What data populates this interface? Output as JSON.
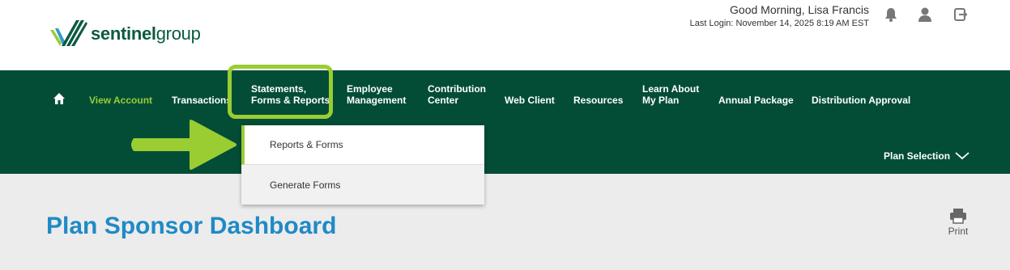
{
  "header": {
    "logo": {
      "bold": "sentinel",
      "light": "group"
    },
    "greeting": "Good Morning,  Lisa Francis",
    "last_login": "Last Login: November 14, 2025 8:19 AM EST",
    "icons": [
      "bell-icon",
      "user-icon",
      "logout-icon"
    ]
  },
  "nav": {
    "items": [
      {
        "line1": "View Account",
        "line2": ""
      },
      {
        "line1": "Transactions",
        "line2": ""
      },
      {
        "line1": "Statements,",
        "line2": "Forms & Reports"
      },
      {
        "line1": "Employee",
        "line2": "Management"
      },
      {
        "line1": "Contribution",
        "line2": "Center"
      },
      {
        "line1": "Web Client",
        "line2": ""
      },
      {
        "line1": "Resources",
        "line2": ""
      },
      {
        "line1": "Learn About",
        "line2": "My Plan"
      },
      {
        "line1": "Annual Package",
        "line2": ""
      },
      {
        "line1": "Distribution Approval",
        "line2": ""
      }
    ],
    "plan_selection": "Plan Selection",
    "active_color": "#9acd32",
    "background": "#034d37"
  },
  "dropdown": {
    "items": [
      "Reports & Forms",
      "Generate Forms"
    ]
  },
  "main": {
    "title": "Plan Sponsor Dashboard",
    "print_label": "Print",
    "title_color": "#1f8ac6"
  }
}
